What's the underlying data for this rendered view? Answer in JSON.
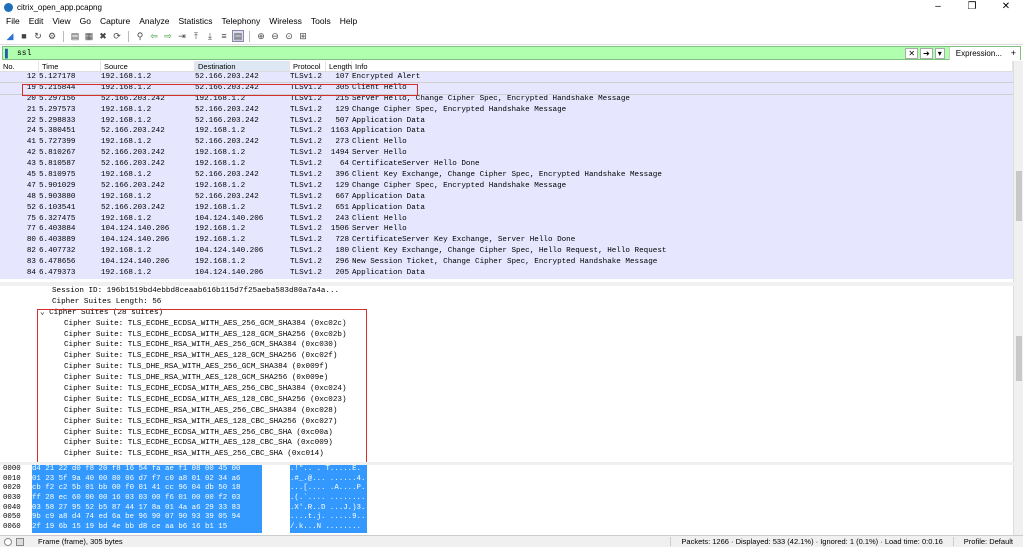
{
  "window": {
    "title": "citrix_open_app.pcapng",
    "controls": [
      "–",
      "❐",
      "✕"
    ]
  },
  "menu": [
    "File",
    "Edit",
    "View",
    "Go",
    "Capture",
    "Analyze",
    "Statistics",
    "Telephony",
    "Wireless",
    "Tools",
    "Help"
  ],
  "toolbar_icons": [
    "shark-fin-start-icon",
    "stop-icon",
    "restart-icon",
    "options-icon",
    "open-icon",
    "save-icon",
    "close-icon",
    "reload-icon",
    "find-icon",
    "back-icon",
    "forward-icon",
    "jump-icon",
    "first-icon",
    "last-icon",
    "autoscroll-icon",
    "colorize-icon",
    "zoom-in-icon",
    "zoom-out-icon",
    "zoom-reset-icon",
    "resize-columns-icon"
  ],
  "filter": {
    "value": "ssl",
    "expression_label": "Expression...",
    "plus": "+"
  },
  "columns": {
    "no": "No.",
    "time": "Time",
    "source": "Source",
    "destination": "Destination",
    "protocol": "Protocol",
    "length": "Length",
    "info": "Info"
  },
  "packets": [
    {
      "no": "12",
      "time": "5.127178",
      "src": "192.168.1.2",
      "dst": "52.166.203.242",
      "proto": "TLSv1.2",
      "len": "107",
      "info": "Encrypted Alert"
    },
    {
      "no": "19",
      "time": "5.215844",
      "src": "192.168.1.2",
      "dst": "52.166.203.242",
      "proto": "TLSv1.2",
      "len": "305",
      "info": "Client Hello"
    },
    {
      "no": "20",
      "time": "5.297156",
      "src": "52.166.203.242",
      "dst": "192.168.1.2",
      "proto": "TLSv1.2",
      "len": "215",
      "info": "Server Hello, Change Cipher Spec, Encrypted Handshake Message"
    },
    {
      "no": "21",
      "time": "5.297573",
      "src": "192.168.1.2",
      "dst": "52.166.203.242",
      "proto": "TLSv1.2",
      "len": "129",
      "info": "Change Cipher Spec, Encrypted Handshake Message"
    },
    {
      "no": "22",
      "time": "5.298833",
      "src": "192.168.1.2",
      "dst": "52.166.203.242",
      "proto": "TLSv1.2",
      "len": "507",
      "info": "Application Data"
    },
    {
      "no": "24",
      "time": "5.380451",
      "src": "52.166.203.242",
      "dst": "192.168.1.2",
      "proto": "TLSv1.2",
      "len": "1163",
      "info": "Application Data"
    },
    {
      "no": "41",
      "time": "5.727399",
      "src": "192.168.1.2",
      "dst": "52.166.203.242",
      "proto": "TLSv1.2",
      "len": "273",
      "info": "Client Hello"
    },
    {
      "no": "42",
      "time": "5.810267",
      "src": "52.166.203.242",
      "dst": "192.168.1.2",
      "proto": "TLSv1.2",
      "len": "1494",
      "info": "Server Hello"
    },
    {
      "no": "43",
      "time": "5.810587",
      "src": "52.166.203.242",
      "dst": "192.168.1.2",
      "proto": "TLSv1.2",
      "len": "64",
      "info": "CertificateServer Hello Done"
    },
    {
      "no": "45",
      "time": "5.810975",
      "src": "192.168.1.2",
      "dst": "52.166.203.242",
      "proto": "TLSv1.2",
      "len": "396",
      "info": "Client Key Exchange, Change Cipher Spec, Encrypted Handshake Message"
    },
    {
      "no": "47",
      "time": "5.901029",
      "src": "52.166.203.242",
      "dst": "192.168.1.2",
      "proto": "TLSv1.2",
      "len": "129",
      "info": "Change Cipher Spec, Encrypted Handshake Message"
    },
    {
      "no": "48",
      "time": "5.903880",
      "src": "192.168.1.2",
      "dst": "52.166.203.242",
      "proto": "TLSv1.2",
      "len": "667",
      "info": "Application Data"
    },
    {
      "no": "52",
      "time": "6.103541",
      "src": "52.166.203.242",
      "dst": "192.168.1.2",
      "proto": "TLSv1.2",
      "len": "651",
      "info": "Application Data"
    },
    {
      "no": "75",
      "time": "6.327475",
      "src": "192.168.1.2",
      "dst": "104.124.140.206",
      "proto": "TLSv1.2",
      "len": "243",
      "info": "Client Hello"
    },
    {
      "no": "77",
      "time": "6.403884",
      "src": "104.124.140.206",
      "dst": "192.168.1.2",
      "proto": "TLSv1.2",
      "len": "1506",
      "info": "Server Hello"
    },
    {
      "no": "80",
      "time": "6.403889",
      "src": "104.124.140.206",
      "dst": "192.168.1.2",
      "proto": "TLSv1.2",
      "len": "728",
      "info": "CertificateServer Key Exchange, Server Hello Done"
    },
    {
      "no": "82",
      "time": "6.407732",
      "src": "192.168.1.2",
      "dst": "104.124.140.206",
      "proto": "TLSv1.2",
      "len": "180",
      "info": "Client Key Exchange, Change Cipher Spec, Hello Request, Hello Request"
    },
    {
      "no": "83",
      "time": "6.478656",
      "src": "104.124.140.206",
      "dst": "192.168.1.2",
      "proto": "TLSv1.2",
      "len": "296",
      "info": "New Session Ticket, Change Cipher Spec, Encrypted Handshake Message"
    },
    {
      "no": "84",
      "time": "6.479373",
      "src": "192.168.1.2",
      "dst": "104.124.140.206",
      "proto": "TLSv1.2",
      "len": "205",
      "info": "Application Data"
    }
  ],
  "selected_packet": "19",
  "details": [
    {
      "indent": 52,
      "text": "Session ID: 196b1519bd4ebbd8ceaab616b115d7f25aeba583d80a7a4a..."
    },
    {
      "indent": 52,
      "text": "Cipher Suites Length: 56"
    },
    {
      "indent": 40,
      "text": "⌄ Cipher Suites (28 suites)"
    },
    {
      "indent": 64,
      "text": "Cipher Suite: TLS_ECDHE_ECDSA_WITH_AES_256_GCM_SHA384 (0xc02c)"
    },
    {
      "indent": 64,
      "text": "Cipher Suite: TLS_ECDHE_ECDSA_WITH_AES_128_GCM_SHA256 (0xc02b)"
    },
    {
      "indent": 64,
      "text": "Cipher Suite: TLS_ECDHE_RSA_WITH_AES_256_GCM_SHA384 (0xc030)"
    },
    {
      "indent": 64,
      "text": "Cipher Suite: TLS_ECDHE_RSA_WITH_AES_128_GCM_SHA256 (0xc02f)"
    },
    {
      "indent": 64,
      "text": "Cipher Suite: TLS_DHE_RSA_WITH_AES_256_GCM_SHA384 (0x009f)"
    },
    {
      "indent": 64,
      "text": "Cipher Suite: TLS_DHE_RSA_WITH_AES_128_GCM_SHA256 (0x009e)"
    },
    {
      "indent": 64,
      "text": "Cipher Suite: TLS_ECDHE_ECDSA_WITH_AES_256_CBC_SHA384 (0xc024)"
    },
    {
      "indent": 64,
      "text": "Cipher Suite: TLS_ECDHE_ECDSA_WITH_AES_128_CBC_SHA256 (0xc023)"
    },
    {
      "indent": 64,
      "text": "Cipher Suite: TLS_ECDHE_RSA_WITH_AES_256_CBC_SHA384 (0xc028)"
    },
    {
      "indent": 64,
      "text": "Cipher Suite: TLS_ECDHE_RSA_WITH_AES_128_CBC_SHA256 (0xc027)"
    },
    {
      "indent": 64,
      "text": "Cipher Suite: TLS_ECDHE_ECDSA_WITH_AES_256_CBC_SHA (0xc00a)"
    },
    {
      "indent": 64,
      "text": "Cipher Suite: TLS_ECDHE_ECDSA_WITH_AES_128_CBC_SHA (0xc009)"
    },
    {
      "indent": 64,
      "text": "Cipher Suite: TLS_ECDHE_RSA_WITH_AES_256_CBC_SHA (0xc014)"
    }
  ],
  "bytes": [
    {
      "off": "0000",
      "hex": "d4 21 22 d0 f8 20 f8 16  54 fa ae f1 08 00 45 00",
      "ascii": ".!\"..  . T.....E."
    },
    {
      "off": "0010",
      "hex": "01 23 5f 9a 40 00 80 06  d7 f7 c0 a8 01 02 34 a6",
      "ascii": ".#_.@... ......4."
    },
    {
      "off": "0020",
      "hex": "cb f2 c2 5b 01 bb 00 f0  01 41 cc 96 04 db 50 18",
      "ascii": "...[.... .A....P."
    },
    {
      "off": "0030",
      "hex": "ff 28 ec 60 00 00 16 03  03 00 f6 01 00 00 f2 03",
      "ascii": ".(.`.... ........"
    },
    {
      "off": "0040",
      "hex": "03 58 27 95 52 b5 87 44  17 8a 01 4a a6 29 33 83",
      "ascii": ".X'.R..D ...J.)3."
    },
    {
      "off": "0050",
      "hex": "9b c9 a8 d4 74 ed 6a be  96 90 07 90 93 39 05 94",
      "ascii": "....t.j. .....9.."
    },
    {
      "off": "0060",
      "hex": "2f 19 6b 15 19 bd 4e  bb d8 ce aa b6 16 b1 15",
      "ascii": "/.k...N ........"
    }
  ],
  "status": {
    "left": "Frame (frame), 305 bytes",
    "packets": "Packets: 1266 · Displayed: 533 (42.1%) · Ignored: 1 (0.1%) · Load time: 0:0.16",
    "profile": "Profile: Default"
  }
}
